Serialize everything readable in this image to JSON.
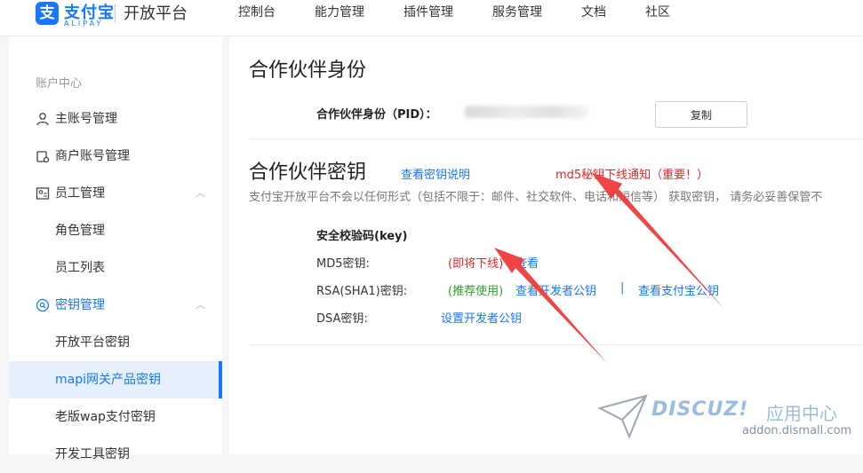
{
  "header": {
    "logo_cn": "支付宝",
    "logo_en": "ALIPAY",
    "platform": "开放平台",
    "nav": [
      "控制台",
      "能力管理",
      "插件管理",
      "服务管理",
      "文档",
      "社区"
    ]
  },
  "sidebar": {
    "section_title": "账户中心",
    "items": [
      {
        "label": "主账号管理",
        "icon": "user-icon"
      },
      {
        "label": "商户账号管理",
        "icon": "shop-icon"
      },
      {
        "label": "员工管理",
        "icon": "staff-icon",
        "expanded": true
      },
      {
        "label": "角色管理"
      },
      {
        "label": "员工列表"
      },
      {
        "label": "密钥管理",
        "icon": "key-search-icon",
        "expanded": true
      },
      {
        "label": "开放平台密钥"
      },
      {
        "label": "mapi网关产品密钥",
        "active": true
      },
      {
        "label": "老版wap支付密钥"
      },
      {
        "label": "开发工具密钥"
      }
    ]
  },
  "main": {
    "section1_title": "合作伙伴身份",
    "pid_label": "合作伙伴身份（PID）：",
    "copy_button": "复制",
    "section2_title": "合作伙伴密钥",
    "key_doc_link": "查看密钥说明",
    "md5_notice": "md5秘钥下线通知（重要！）",
    "notice_text": "支付宝开放平台不会以任何形式（包括不限于：邮件、社交软件、电话和短信等） 获取密钥， 请务必妥善保管不",
    "security_title": "安全校验码(key)",
    "rows": [
      {
        "label": "MD5密钥:",
        "status": "(即将下线)",
        "links": [
          "查看"
        ]
      },
      {
        "label": "RSA(SHA1)密钥:",
        "status": "(推荐使用)",
        "links": [
          "查看开发者公钥",
          "查看支付宝公钥"
        ],
        "sep": "|"
      },
      {
        "label": "DSA密钥:",
        "links": [
          "设置开发者公钥"
        ]
      }
    ]
  },
  "watermark": {
    "brand": "DISCUZ!",
    "cn": "应用中心",
    "url": "addon.dismall.com"
  },
  "colors": {
    "accent": "#1677ff",
    "red": "#e4252c",
    "green": "#2a9d2a",
    "arrow": "#ee3b3b"
  }
}
